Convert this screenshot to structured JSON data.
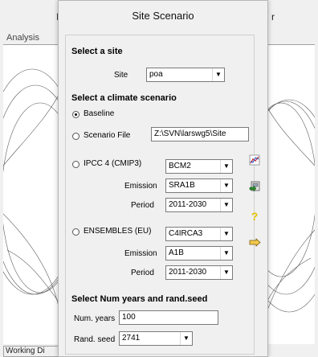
{
  "background": {
    "title_left_fragment": "I",
    "title_right_fragment": "r",
    "tab_label": "Analysis",
    "status_text": "Working Di"
  },
  "dialog": {
    "title": "Site Scenario",
    "site_section": {
      "heading": "Select a site",
      "site_label": "Site",
      "site_value": "poa"
    },
    "climate_section": {
      "heading": "Select a climate scenario",
      "baseline_label": "Baseline",
      "baseline_selected": true,
      "scenario_file_label": "Scenario File",
      "scenario_file_value": "Z:\\SVN\\larswg5\\Site",
      "ipcc": {
        "label": "IPCC 4 (CMIP3)",
        "model": "BCM2",
        "emission_label": "Emission",
        "emission": "SRA1B",
        "period_label": "Period",
        "period": "2011-2030"
      },
      "ensembles": {
        "label": "ENSEMBLES (EU)",
        "model": "C4IRCA3",
        "emission_label": "Emission",
        "emission": "A1B",
        "period_label": "Period",
        "period": "2011-2030"
      }
    },
    "years_section": {
      "heading": "Select Num years and rand.seed",
      "num_years_label": "Num. years",
      "num_years_value": "100",
      "rand_seed_label": "Rand. seed",
      "rand_seed_value": "2741"
    },
    "tools": {
      "chart_icon": "chart-icon",
      "import_icon": "import-icon",
      "help_icon": "help-icon",
      "pointer_icon": "pointer-icon"
    },
    "colors": {
      "help": "#e8c200",
      "chart_red": "#cc2222",
      "chart_blue": "#2255cc"
    }
  }
}
